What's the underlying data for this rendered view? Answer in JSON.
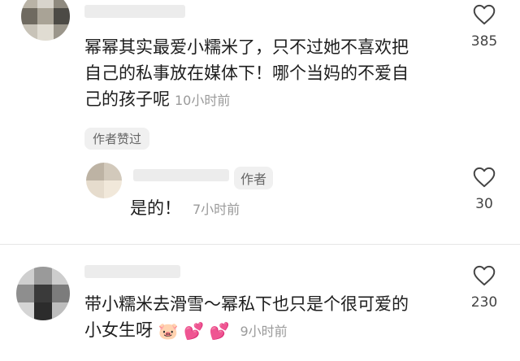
{
  "comments": [
    {
      "text_line1": "幂幂其实最爱小糯米了，只不过她不喜欢把",
      "text_line2": "自己的私事放在媒体下！哪个当妈的不爱自",
      "text_line3": "己的孩子呢",
      "time": "10小时前",
      "badge": "作者赞过",
      "likes": "385",
      "avatar_colors": [
        "#b9b3a6",
        "#d8d4cc",
        "#8f8a7f",
        "#6f6a60",
        "#a9a396",
        "#4c4a45",
        "#c8c3b8",
        "#e0dcd2",
        "#9b968b"
      ]
    },
    {
      "author_tag": "作者",
      "text": "是的！",
      "time": "7小时前",
      "likes": "30",
      "avatar_colors": [
        "#bdb3a4",
        "#d2c9bb",
        "#e6dccd",
        "#f1e8da"
      ]
    },
    {
      "text_line1": "带小糯米去滑雪～幂私下也只是个很可爱的",
      "text_line2": "小女生呀",
      "emojis": [
        "🐷",
        "💕",
        "💕"
      ],
      "time": "9小时前",
      "likes": "230",
      "avatar_colors": [
        "#cfcfcf",
        "#9a9a9a",
        "#cdcdcd",
        "#8e8e8e",
        "#3a3a3a",
        "#7c7c7c",
        "#d5d5d5",
        "#2c2c2c",
        "#bdbdbd"
      ]
    }
  ],
  "icons": {
    "like": "heart-outline-icon"
  }
}
